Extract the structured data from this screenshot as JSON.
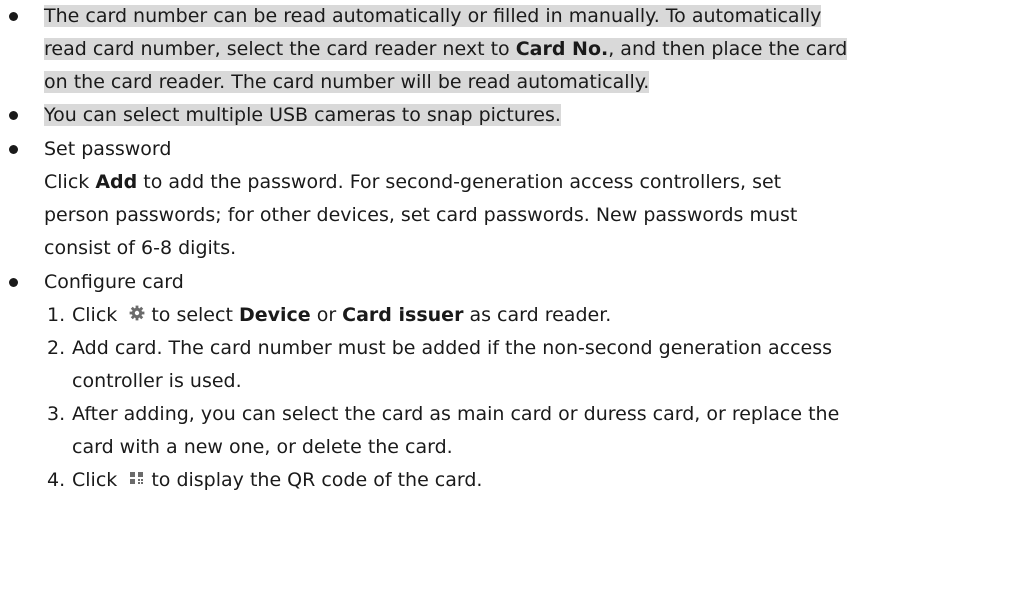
{
  "bullets": {
    "b1": {
      "l1": "The card number can be read automatically or filled in manually. To automatically",
      "l2a": "read card number, select the card reader next to ",
      "l2b": "Card No.",
      "l2c": ", and then place the card",
      "l3": "on the card reader. The card number will be read automatically."
    },
    "b2": {
      "l1": "You can select multiple USB cameras to snap pictures."
    },
    "b3": {
      "title": "Set password",
      "l1a": "Click ",
      "l1b": "Add",
      "l1c": " to add the password. For second-generation access controllers, set",
      "l2": "person passwords; for other devices, set card passwords. New passwords must",
      "l3": "consist of 6-8 digits."
    },
    "b4": {
      "title": "Configure card",
      "steps": {
        "s1": {
          "n": "1.",
          "a": "Click",
          "icon": "gear-icon",
          "b": "to select ",
          "c": "Device",
          "d": " or ",
          "e": "Card issuer",
          "f": " as card reader."
        },
        "s2": {
          "n": "2.",
          "l1": "Add card. The card number must be added if the non-second generation access",
          "l2": "controller is used."
        },
        "s3": {
          "n": "3.",
          "l1": "After adding, you can select the card as main card or duress card, or replace the",
          "l2": "card with a new one, or delete the card."
        },
        "s4": {
          "n": "4.",
          "a": "Click",
          "icon": "qr-code-icon",
          "b": "to display the QR code of the card."
        }
      }
    }
  }
}
